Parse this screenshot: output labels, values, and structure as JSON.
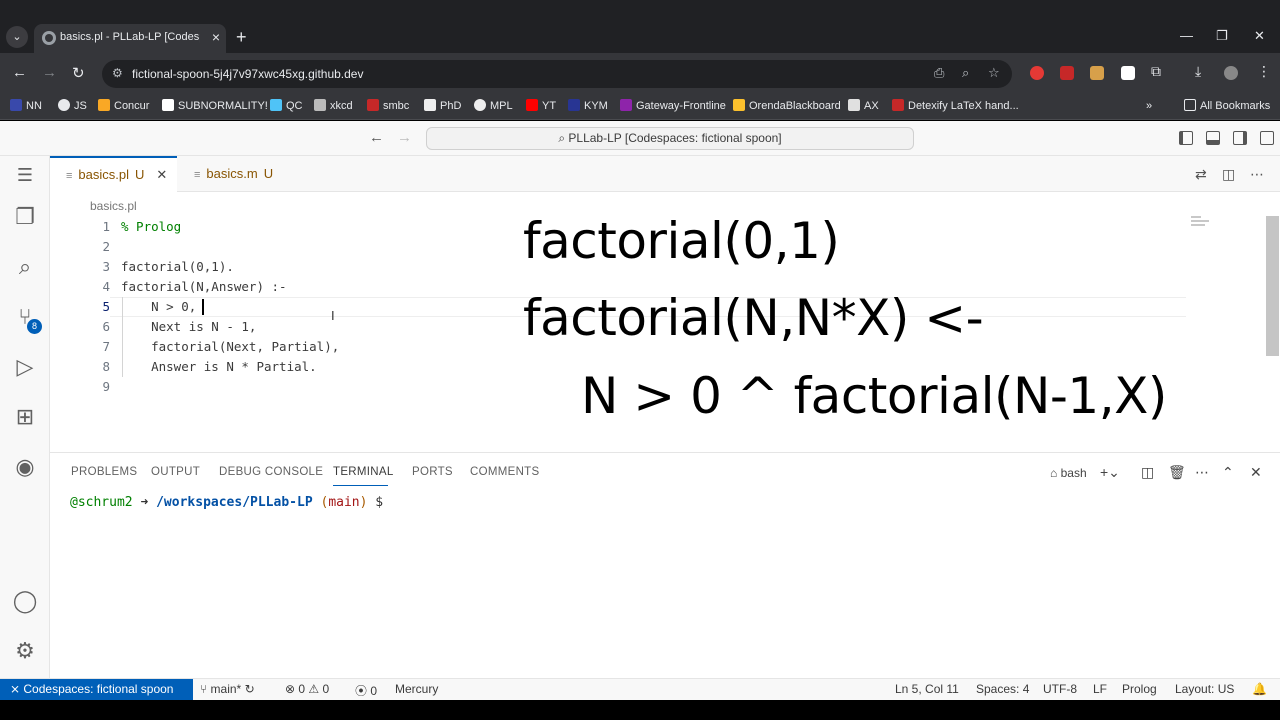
{
  "browser": {
    "tab_title": "basics.pl - PLLab-LP [Codespaces: fictional spoon]",
    "url": "fictional-spoon-5j4j7v97xwc45xg.github.dev",
    "bookmarks": [
      "NN",
      "JS",
      "Concur",
      "SUBNORMALITY!",
      "QC",
      "xkcd",
      "smbc",
      "PhD",
      "MPL",
      "YT",
      "KYM",
      "Gateway-Frontline",
      "OrendaBlackboard",
      "AX",
      "Detexify LaTeX hand..."
    ],
    "all_bookmarks": "All Bookmarks"
  },
  "vscode": {
    "command_center": "PLLab-LP [Codespaces: fictional spoon]",
    "tabs": [
      {
        "name": "basics.pl",
        "status": "U"
      },
      {
        "name": "basics.m",
        "status": "U"
      }
    ],
    "breadcrumb": "basics.pl",
    "scm_badge": "8",
    "code": {
      "line_numbers": [
        "1",
        "2",
        "3",
        "4",
        "5",
        "6",
        "7",
        "8",
        "9"
      ],
      "lines": [
        "% Prolog",
        "",
        "factorial(0,1).",
        "factorial(N,Answer) :-",
        "    N > 0,",
        "    Next is N - 1,",
        "    factorial(Next, Partial),",
        "    Answer is N * Partial.",
        ""
      ]
    },
    "overlay": {
      "line1": "factorial(0,1)",
      "line2": "factorial(N,N*X) <-",
      "line3": "N > 0 ^ factorial(N-1,X)"
    },
    "panel": {
      "tabs": [
        "PROBLEMS",
        "OUTPUT",
        "DEBUG CONSOLE",
        "TERMINAL",
        "PORTS",
        "COMMENTS"
      ],
      "shell": "bash",
      "terminal": {
        "user": "@schrum2",
        "arrow": "➜",
        "path": "/workspaces/PLLab-LP",
        "branch_open": "(",
        "branch": "main",
        "branch_close": ")",
        "prompt": "$"
      }
    },
    "statusbar": {
      "remote": "Codespaces: fictional spoon",
      "branch": "main*",
      "errors": "0",
      "warnings": "0",
      "ports": "0",
      "extension": "Mercury",
      "position": "Ln 5, Col 11",
      "spaces": "Spaces: 4",
      "encoding": "UTF-8",
      "eol": "LF",
      "language": "Prolog",
      "layout": "Layout: US"
    }
  }
}
